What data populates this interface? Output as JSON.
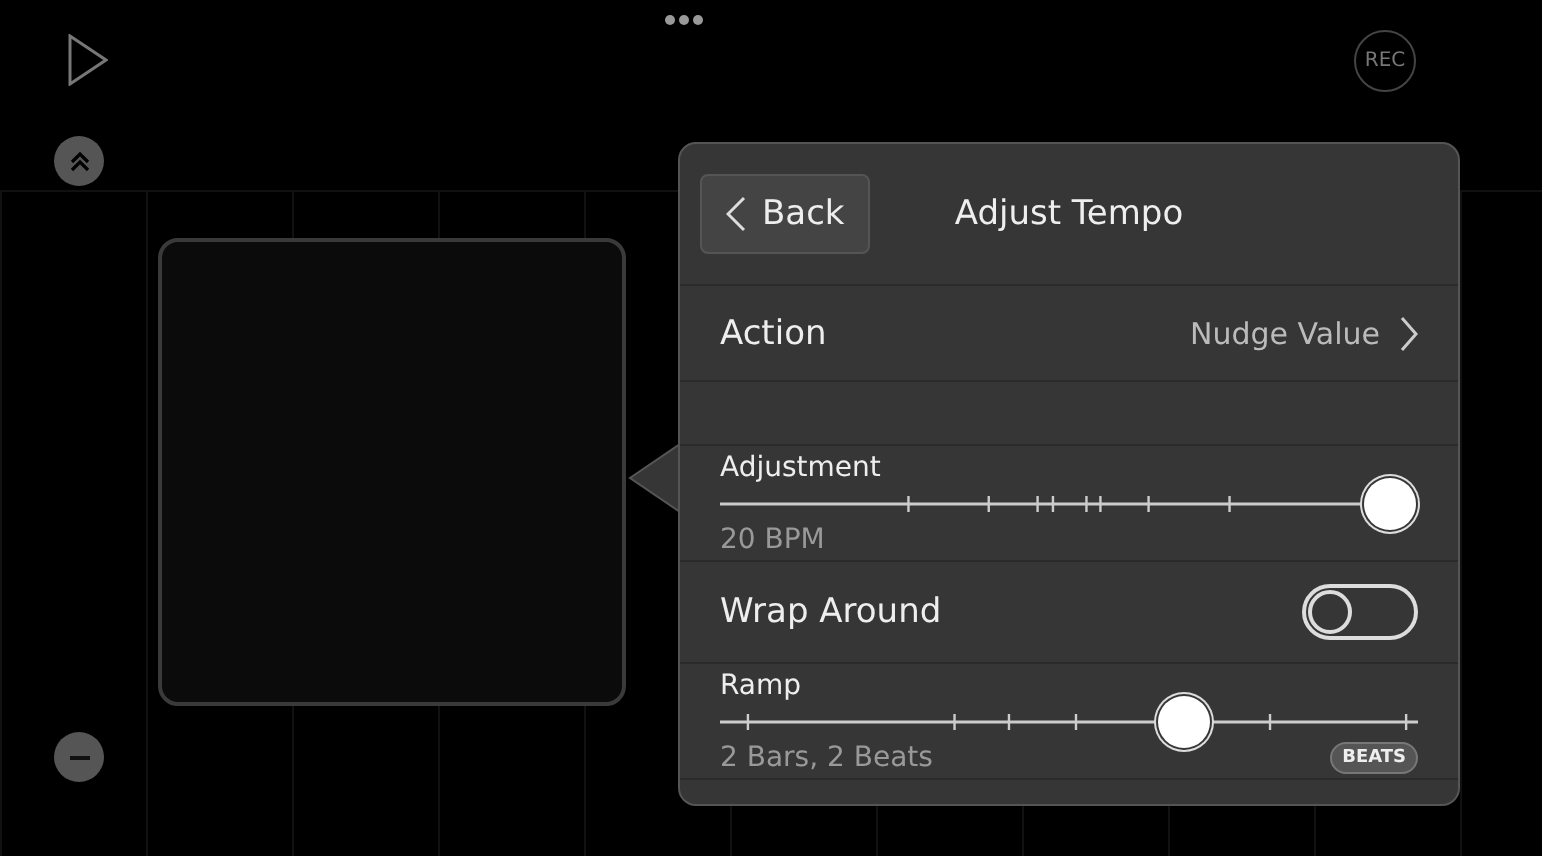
{
  "top_bar": {
    "rec_label": "REC"
  },
  "popover": {
    "back_label": "Back",
    "title": "Adjust Tempo",
    "rows": [
      {
        "kind": "nav",
        "label": "Action",
        "value": "Nudge Value"
      },
      {
        "kind": "spacer"
      },
      {
        "kind": "slider",
        "label": "Adjustment",
        "reading": "20 BPM",
        "level": 1
      },
      {
        "kind": "toggle",
        "label": "Wrap Around",
        "on": false
      },
      {
        "kind": "slider",
        "label": "Ramp",
        "reading": "2 Bars, 2 Beats",
        "level": 0.68,
        "badge": "BEATS"
      }
    ]
  }
}
